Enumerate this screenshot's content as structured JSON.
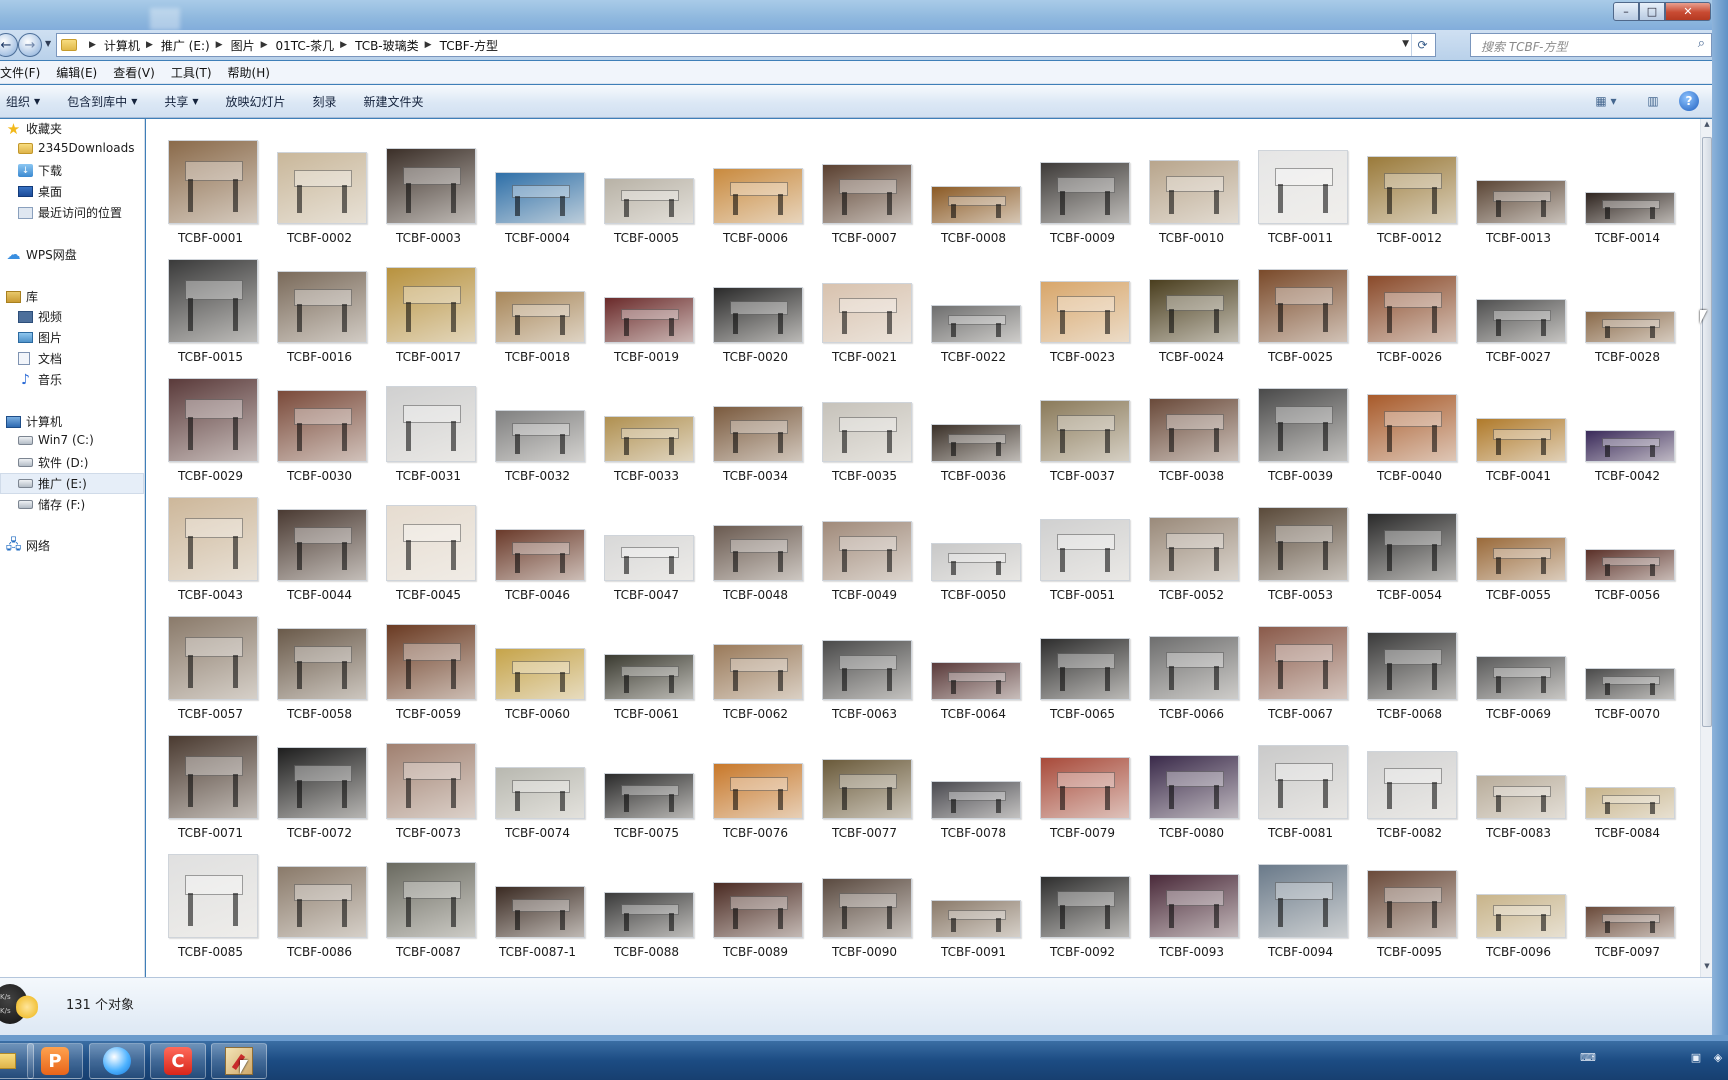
{
  "window": {
    "controls": {
      "minimize": "–",
      "maximize": "□",
      "close": "✕"
    }
  },
  "nav": {
    "back_icon": "←",
    "forward_icon": "→",
    "breadcrumbs": [
      "计算机",
      "推广 (E:)",
      "图片",
      "01TC-茶几",
      "TCB-玻璃类",
      "TCBF-方型"
    ],
    "search_placeholder": "搜索 TCBF-方型"
  },
  "menubar": [
    "文件(F)",
    "编辑(E)",
    "查看(V)",
    "工具(T)",
    "帮助(H)"
  ],
  "toolbar": {
    "organize": "组织",
    "include_in_library": "包含到库中",
    "share": "共享",
    "slideshow": "放映幻灯片",
    "burn": "刻录",
    "new_folder": "新建文件夹"
  },
  "sidebar": {
    "favorites": "收藏夹",
    "fav_items": [
      "2345Downloads",
      "下载",
      "桌面",
      "最近访问的位置"
    ],
    "wps": "WPS网盘",
    "library": "库",
    "lib_items": [
      "视频",
      "图片",
      "文档",
      "音乐"
    ],
    "computer": "计算机",
    "drives": [
      "Win7 (C:)",
      "软件 (D:)",
      "推广 (E:)",
      "储存 (F:)"
    ],
    "network": "网络"
  },
  "files": [
    "TCBF-0001",
    "TCBF-0002",
    "TCBF-0003",
    "TCBF-0004",
    "TCBF-0005",
    "TCBF-0006",
    "TCBF-0007",
    "TCBF-0008",
    "TCBF-0009",
    "TCBF-0010",
    "TCBF-0011",
    "TCBF-0012",
    "TCBF-0013",
    "TCBF-0014",
    "TCBF-0015",
    "TCBF-0016",
    "TCBF-0017",
    "TCBF-0018",
    "TCBF-0019",
    "TCBF-0020",
    "TCBF-0021",
    "TCBF-0022",
    "TCBF-0023",
    "TCBF-0024",
    "TCBF-0025",
    "TCBF-0026",
    "TCBF-0027",
    "TCBF-0028",
    "TCBF-0029",
    "TCBF-0030",
    "TCBF-0031",
    "TCBF-0032",
    "TCBF-0033",
    "TCBF-0034",
    "TCBF-0035",
    "TCBF-0036",
    "TCBF-0037",
    "TCBF-0038",
    "TCBF-0039",
    "TCBF-0040",
    "TCBF-0041",
    "TCBF-0042",
    "TCBF-0043",
    "TCBF-0044",
    "TCBF-0045",
    "TCBF-0046",
    "TCBF-0047",
    "TCBF-0048",
    "TCBF-0049",
    "TCBF-0050",
    "TCBF-0051",
    "TCBF-0052",
    "TCBF-0053",
    "TCBF-0054",
    "TCBF-0055",
    "TCBF-0056",
    "TCBF-0057",
    "TCBF-0058",
    "TCBF-0059",
    "TCBF-0060",
    "TCBF-0061",
    "TCBF-0062",
    "TCBF-0063",
    "TCBF-0064",
    "TCBF-0065",
    "TCBF-0066",
    "TCBF-0067",
    "TCBF-0068",
    "TCBF-0069",
    "TCBF-0070",
    "TCBF-0071",
    "TCBF-0072",
    "TCBF-0073",
    "TCBF-0074",
    "TCBF-0075",
    "TCBF-0076",
    "TCBF-0077",
    "TCBF-0078",
    "TCBF-0079",
    "TCBF-0080",
    "TCBF-0081",
    "TCBF-0082",
    "TCBF-0083",
    "TCBF-0084",
    "TCBF-0085",
    "TCBF-0086",
    "TCBF-0087",
    "TCBF-0087-1",
    "TCBF-0088",
    "TCBF-0089",
    "TCBF-0090",
    "TCBF-0091",
    "TCBF-0092",
    "TCBF-0093",
    "TCBF-0094",
    "TCBF-0095",
    "TCBF-0096",
    "TCBF-0097"
  ],
  "thumb_colors": [
    "#8a6a4a",
    "#c9b79a",
    "#3b2f28",
    "#2e6fa8",
    "#b8b2a6",
    "#c98a3e",
    "#5a4030",
    "#8b5a25",
    "#3d3a38",
    "#b8a58c",
    "#e6e6e6",
    "#9a7a3a",
    "#5b4636",
    "#2f2520",
    "#3a3a3a",
    "#7a6a5a",
    "#b8923e",
    "#a8875a",
    "#6a2a2a",
    "#2a2a2a",
    "#d8c2ae",
    "#6e6e6e",
    "#d8a66a",
    "#4a3e1e",
    "#7a4a2a",
    "#8a4a2a",
    "#505050",
    "#8a6a4a",
    "#5a3a3a",
    "#7a4a3a",
    "#d0d0d0",
    "#808080",
    "#b09050",
    "#7a5a3e",
    "#c6c2ba",
    "#3a3028",
    "#8a7a5a",
    "#6a4a3a",
    "#4a4a4a",
    "#a85a2a",
    "#b07a2a",
    "#3a2a5a",
    "#cdb79a",
    "#4a3a32",
    "#e6dcd0",
    "#6a3a2a",
    "#d8d8d8",
    "#6a5a50",
    "#a08a7a",
    "#c8c8c8",
    "#d0d0d0",
    "#9a8a7a",
    "#5a4a3a",
    "#2a2a2a",
    "#9a6a3a",
    "#5a3028",
    "#8a7a6a",
    "#6a5a4a",
    "#6a3a22",
    "#c6a44a",
    "#3a3a30",
    "#9a7a5a",
    "#4a4a4a",
    "#5a3a3a",
    "#2e2e2e",
    "#6e6e6e",
    "#8a5a4a",
    "#3a3a3a",
    "#5a5a5a",
    "#4a4a4a",
    "#4a3a30",
    "#1e1e1e",
    "#a08070",
    "#b8b8b0",
    "#2a2a2a",
    "#c8782a",
    "#6a5a3a",
    "#4a4a50",
    "#a84a3a",
    "#3a2a4a",
    "#cacaca",
    "#d2d2d2",
    "#b8ac9a",
    "#c8b48a",
    "#e0e0e0",
    "#8a7a6a",
    "#6a6a60",
    "#3a2a22",
    "#3a3a3a",
    "#4a2a22",
    "#5a4a40",
    "#8a7a6a",
    "#2e2e2e",
    "#4a2a3a",
    "#6a7a8a",
    "#6a4a3a",
    "#c8b48a",
    "#6a4a3a"
  ],
  "status": {
    "count": "131 个对象",
    "speed_top": "K/s",
    "speed_bottom": "K/s"
  },
  "taskbar": {
    "wps_label": "P",
    "c_label": "C"
  }
}
